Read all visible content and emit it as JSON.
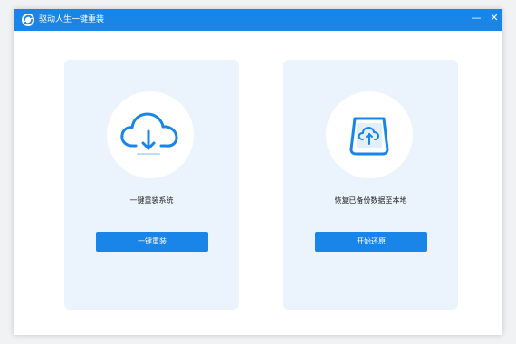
{
  "window": {
    "title": "驱动人生一键重装",
    "minimize_glyph": "—",
    "close_glyph": "✕",
    "icon": "app-logo-icon"
  },
  "cards": [
    {
      "icon": "cloud-download-icon",
      "label": "一键重装系统",
      "button_label": "一键重装"
    },
    {
      "icon": "cloud-upload-icon",
      "label": "恢复已备份数据至本地",
      "button_label": "开始还原"
    }
  ],
  "colors": {
    "accent": "#1a85e8",
    "card_background": "#ebf4fd",
    "window_background": "#ffffff"
  }
}
